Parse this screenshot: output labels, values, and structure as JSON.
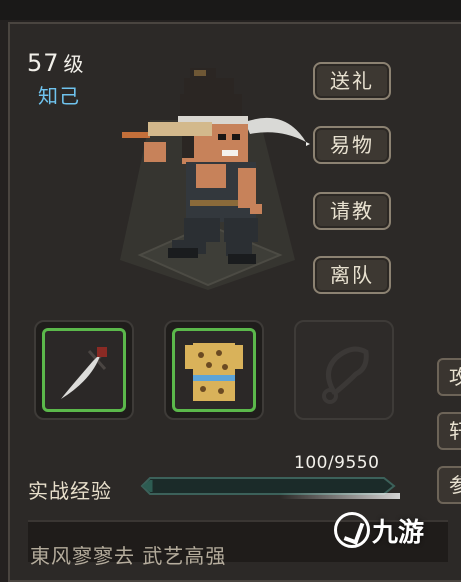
{
  "character": {
    "level": "57",
    "level_unit": "级",
    "relation": "知己"
  },
  "actions": [
    {
      "label": "送礼"
    },
    {
      "label": "易物"
    },
    {
      "label": "请教"
    },
    {
      "label": "离队"
    }
  ],
  "equipment": {
    "weapon": "weapon-machete",
    "armor": "armor-leopard-vest",
    "accessory": "accessory-empty-slot"
  },
  "experience": {
    "label": "实战经验",
    "value": "100/9550",
    "progress": 0.0105
  },
  "side_tabs": [
    "攻",
    "轩",
    "参"
  ],
  "bottom_info": "東风寥寥去   武艺高强",
  "watermark": "九游",
  "colors": {
    "level_text": "#f2f0ea",
    "relation_text": "#6fc3ee",
    "slot_highlight": "#5bb84b",
    "exp_bar_fill": "#2d5c52"
  }
}
